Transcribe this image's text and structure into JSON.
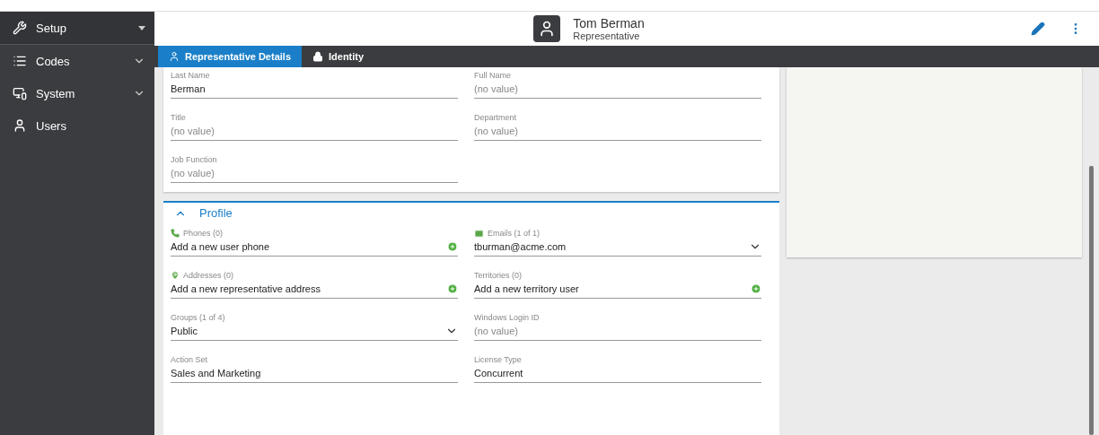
{
  "sidebar": {
    "items": [
      {
        "label": "Setup",
        "selected": true
      },
      {
        "label": "Codes",
        "selected": false
      },
      {
        "label": "System",
        "selected": false
      },
      {
        "label": "Users",
        "selected": false
      }
    ]
  },
  "header": {
    "name": "Tom Berman",
    "role": "Representative"
  },
  "tabs": [
    {
      "label": "Representative Details",
      "selected": true
    },
    {
      "label": "Identity",
      "selected": false
    }
  ],
  "details": {
    "fields": [
      {
        "label": "Last Name",
        "value": "Berman"
      },
      {
        "label": "Full Name",
        "placeholder": "(no value)"
      },
      {
        "label": "Title",
        "placeholder": "(no value)"
      },
      {
        "label": "Department",
        "placeholder": "(no value)"
      },
      {
        "label": "Job Function",
        "placeholder": "(no value)"
      }
    ]
  },
  "profile": {
    "title": "Profile",
    "expanded": true,
    "fields": [
      {
        "kind": "add",
        "label": "Phones (0)",
        "value": "Add a new user phone"
      },
      {
        "kind": "list",
        "label": "Emails (1 of 1)",
        "value": "tburman@acme.com"
      },
      {
        "kind": "add",
        "label": "Addresses (0)",
        "value": "Add a new representative address"
      },
      {
        "kind": "add",
        "label": "Territories (0)",
        "value": "Add a new territory user"
      },
      {
        "kind": "list",
        "label": "Groups (1 of 4)",
        "value": "Public"
      },
      {
        "kind": "text",
        "label": "Windows Login ID",
        "placeholder": "(no value)"
      },
      {
        "kind": "text",
        "label": "Action Set",
        "value": "Sales and Marketing"
      },
      {
        "kind": "text",
        "label": "License Type",
        "value": "Concurrent"
      }
    ]
  }
}
